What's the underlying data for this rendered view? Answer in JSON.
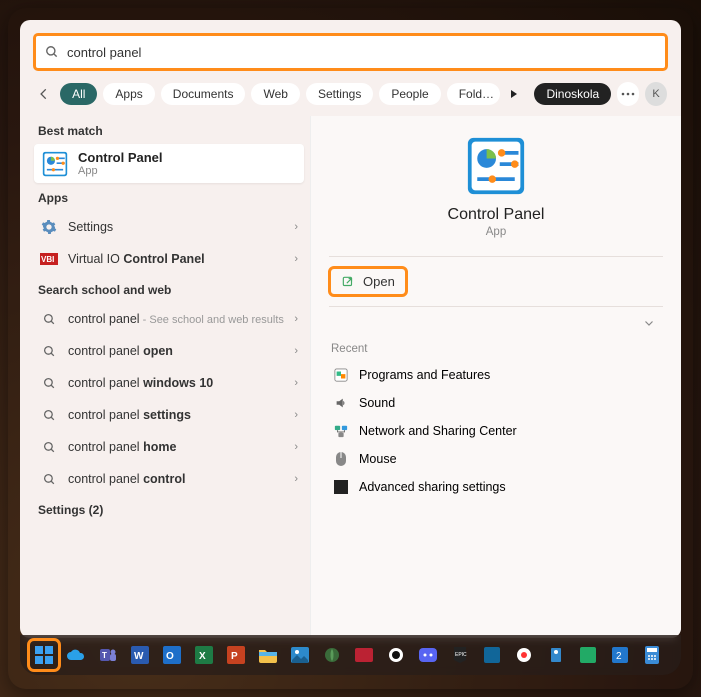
{
  "search": {
    "value": "control panel"
  },
  "filters": {
    "items": [
      "All",
      "Apps",
      "Documents",
      "Web",
      "Settings",
      "People",
      "Folders"
    ],
    "selected": 0
  },
  "profile": {
    "pill_label": "Dinoskola",
    "avatar_initial": "K"
  },
  "left": {
    "best_match_label": "Best match",
    "best_match": {
      "title": "Control Panel",
      "subtitle": "App"
    },
    "apps_label": "Apps",
    "apps": [
      {
        "label": "Settings"
      },
      {
        "label_pre": "Virtual IO ",
        "label_bold": "Control Panel"
      }
    ],
    "web_label": "Search school and web",
    "web": [
      {
        "term": "control panel",
        "suffix": " - See school and web results"
      },
      {
        "term_pre": "control panel ",
        "term_bold": "open"
      },
      {
        "term_pre": "control panel ",
        "term_bold": "windows 10"
      },
      {
        "term_pre": "control panel ",
        "term_bold": "settings"
      },
      {
        "term_pre": "control panel ",
        "term_bold": "home"
      },
      {
        "term_pre": "control panel ",
        "term_bold": "control"
      }
    ],
    "settings_label": "Settings (2)"
  },
  "preview": {
    "title": "Control Panel",
    "subtitle": "App",
    "open_label": "Open",
    "recent_label": "Recent",
    "recent": [
      "Programs and Features",
      "Sound",
      "Network and Sharing Center",
      "Mouse",
      "Advanced sharing settings"
    ]
  }
}
